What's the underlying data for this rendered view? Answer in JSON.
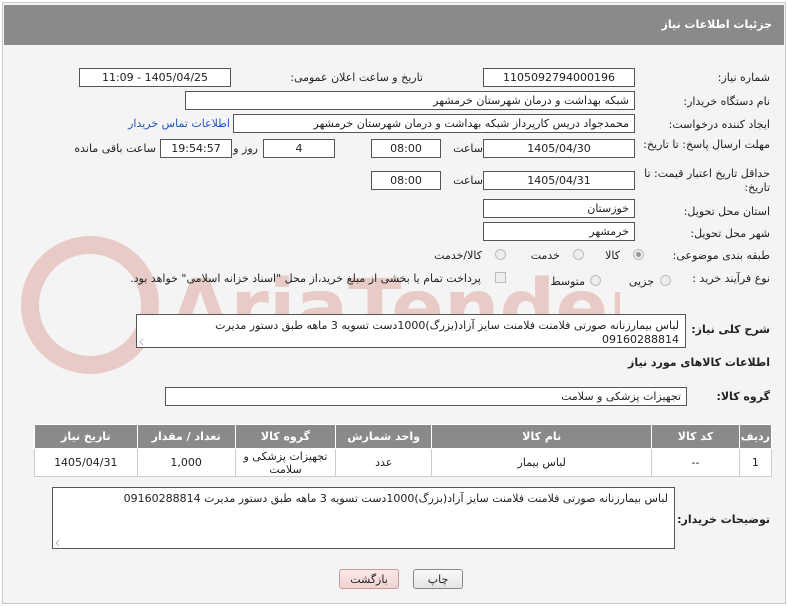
{
  "title": "جزئیات اطلاعات نیاز",
  "fields": {
    "need_number_label": "شماره نیاز:",
    "need_number": "1105092794000196",
    "announce_label": "تاریخ و ساعت اعلان عمومی:",
    "announce_value": "1405/04/25 - 11:09",
    "buyer_org_label": "نام دستگاه خریدار:",
    "buyer_org": "شبکه بهداشت و درمان شهرستان خرمشهر",
    "creator_label": "ایجاد کننده درخواست:",
    "creator": "محمدجواد دریس کارپرداز شبکه بهداشت و درمان شهرستان خرمشهر",
    "contact_link": "اطلاعات تماس خریدار",
    "reply_deadline_label": "مهلت ارسال پاسخ: تا تاریخ:",
    "reply_date": "1405/04/30",
    "time_label": "ساعت",
    "reply_time": "08:00",
    "days_value": "4",
    "days_label": "روز و",
    "remaining_time": "19:54:57",
    "remaining_label": "ساعت باقی مانده",
    "price_validity_label": "حداقل تاریخ اعتبار قیمت: تا تاریخ:",
    "price_date": "1405/04/31",
    "price_time": "08:00",
    "province_label": "استان محل تحویل:",
    "province": "خوزستان",
    "city_label": "شهر محل تحویل:",
    "city": "خرمشهر",
    "category_label": "طبقه بندی موضوعی:",
    "category_options": [
      "کالا",
      "خدمت",
      "کالا/خدمت"
    ],
    "process_label": "نوع فرآیند خرید :",
    "process_options": [
      "جزیی",
      "متوسط"
    ],
    "payment_note": "پرداخت تمام یا بخشی از مبلغ خرید،از محل \"اسناد خزانه اسلامی\" خواهد بود.",
    "description_label": "شرح کلی نیاز:",
    "description": "لباس بیمارزنانه صورتی فلامنت فلامنت سایز آزاد(بزرگ)1000دست تسویه 3 ماهه طبق دستور مدیرت 09160288814",
    "goods_info_title": "اطلاعات کالاهای مورد نیاز",
    "goods_group_label": "گروه کالا:",
    "goods_group": "تجهیزات پزشکی و سلامت"
  },
  "table": {
    "headers": [
      "ردیف",
      "کد کالا",
      "نام کالا",
      "واحد شمارش",
      "گروه کالا",
      "تعداد / مقدار",
      "تاریخ نیاز"
    ],
    "rows": [
      [
        "1",
        "--",
        "لباس بیمار",
        "عدد",
        "تجهیزات پزشکی و سلامت",
        "1,000",
        "1405/04/31"
      ]
    ]
  },
  "buyer_notes_label": "توضیحات خریدار:",
  "buyer_notes": "لباس بیمارزنانه صورتی فلامنت فلامنت سایز آزاد(بزرگ)1000دست تسویه 3 ماهه طبق دستور مدیرت 09160288814",
  "buttons": {
    "print": "چاپ",
    "back": "بازگشت"
  },
  "watermark_text": "AriaTender.net"
}
